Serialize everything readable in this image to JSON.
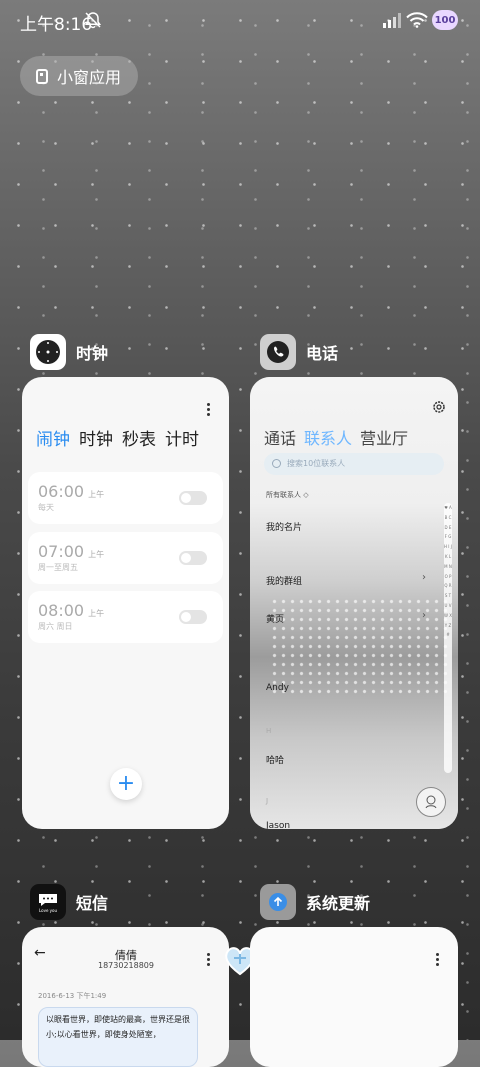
{
  "status_bar": {
    "time": "上午8:16",
    "battery": "100"
  },
  "floating_button": {
    "label": "小窗应用"
  },
  "apps": {
    "clock": {
      "name": "时钟",
      "tabs": [
        "闹钟",
        "时钟",
        "秒表",
        "计时"
      ],
      "alarms": [
        {
          "time": "06:00",
          "ampm": "上午",
          "repeat": "每天"
        },
        {
          "time": "07:00",
          "ampm": "上午",
          "repeat": "周一至周五"
        },
        {
          "time": "08:00",
          "ampm": "上午",
          "repeat": "周六 周日"
        }
      ],
      "add": "+"
    },
    "phone": {
      "name": "电话",
      "tabs": [
        "通话",
        "联系人",
        "营业厅"
      ],
      "search_placeholder": "搜索10位联系人",
      "group_label": "所有联系人",
      "rows": [
        "我的名片",
        "我的群组",
        "黄页",
        "Andy",
        "哈哈",
        "Jason"
      ],
      "section_letters": [
        "H",
        "J"
      ],
      "alphabet": "♥ A B C D E F G H I J K L M N O P Q R S T U V W X Y Z #"
    },
    "sms": {
      "name": "短信",
      "contact_name": "倩倩",
      "contact_number": "18730218809",
      "date": "2016-6-13 下午1:49",
      "message": "以眼看世界，即使站的最高，世界还是很小;以心看世界，即使身处陋室，"
    },
    "update": {
      "name": "系统更新"
    }
  },
  "icon_labels": {
    "love_you": "Love you"
  }
}
